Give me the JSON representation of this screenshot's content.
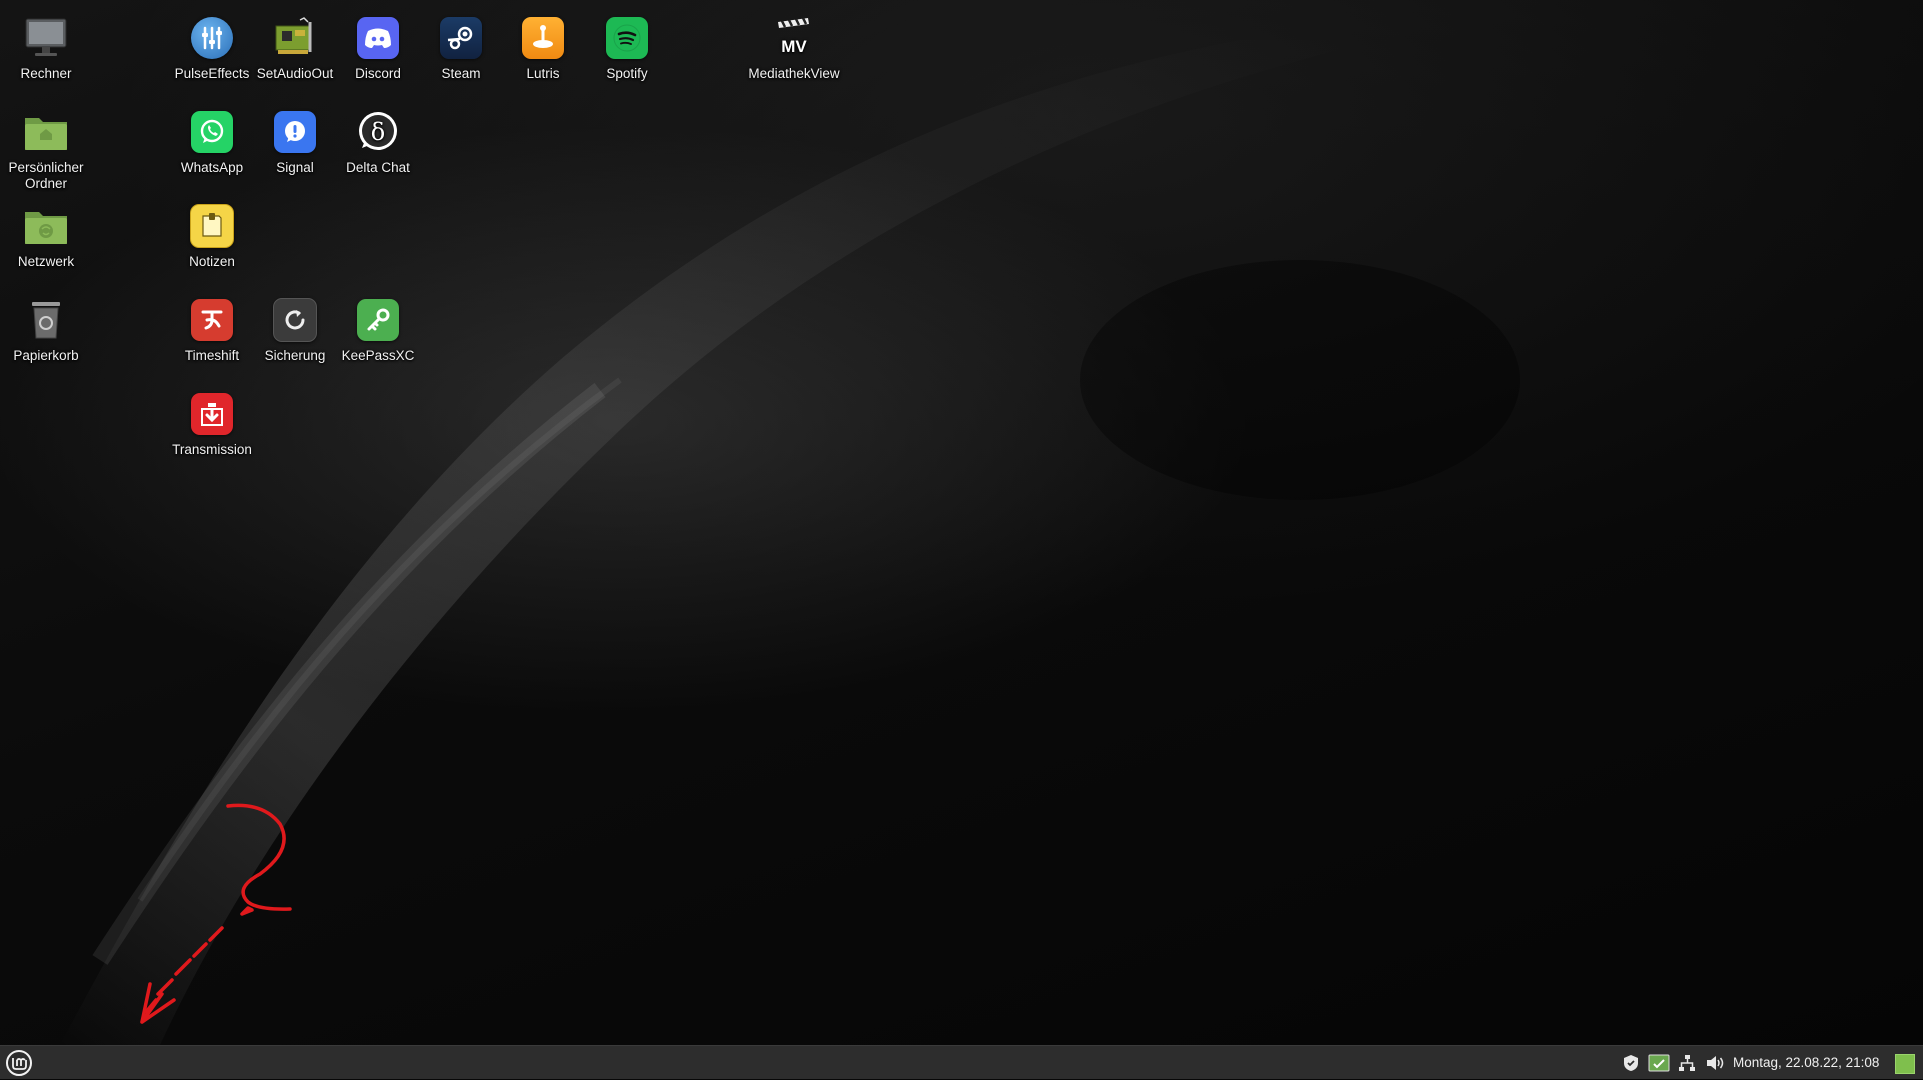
{
  "desktop_icons": {
    "rechner": "Rechner",
    "persoenlicher_ordner": "Persönlicher Ordner",
    "netzwerk": "Netzwerk",
    "papierkorb": "Papierkorb",
    "pulseeffects": "PulseEffects",
    "setaudioout": "SetAudioOut",
    "discord": "Discord",
    "steam": "Steam",
    "lutris": "Lutris",
    "spotify": "Spotify",
    "mediathekview": "MediathekView",
    "mediathekview_logo": "MV",
    "whatsapp": "WhatsApp",
    "signal": "Signal",
    "delta_chat": "Delta Chat",
    "notizen": "Notizen",
    "timeshift": "Timeshift",
    "sicherung": "Sicherung",
    "keepassxc": "KeePassXC",
    "transmission": "Transmission"
  },
  "annotation": {
    "glyph": "?",
    "color": "#e0191c"
  },
  "panel": {
    "clock": "Montag, 22.08.22, 21:08",
    "tray_icons": [
      "shield-icon",
      "update-manager-icon",
      "network-icon",
      "volume-icon"
    ],
    "show_desktop_color": "#7fbf4d"
  }
}
